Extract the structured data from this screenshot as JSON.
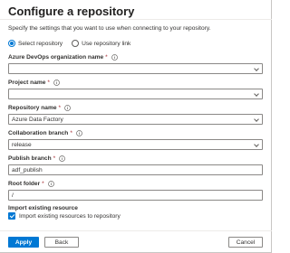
{
  "header": {
    "title": "Configure a repository",
    "subtitle": "Specify the settings that you want to use when connecting to your repository."
  },
  "source_options": [
    {
      "label": "Select repository",
      "checked": true
    },
    {
      "label": "Use repository link",
      "checked": false
    }
  ],
  "fields": {
    "organization": {
      "label": "Azure DevOps organization name",
      "required": true,
      "value": ""
    },
    "project": {
      "label": "Project name",
      "required": true,
      "value": ""
    },
    "repository": {
      "label": "Repository name",
      "required": true,
      "value": "Azure Data Factory"
    },
    "collaboration_branch": {
      "label": "Collaboration branch",
      "required": true,
      "value": "release"
    },
    "publish_branch": {
      "label": "Publish branch",
      "required": true,
      "value": "adf_publish"
    },
    "root_folder": {
      "label": "Root folder",
      "required": true,
      "value": "/"
    }
  },
  "import": {
    "label": "Import existing resource",
    "checkbox_label": "Import existing resources to repository",
    "checked": true
  },
  "footer": {
    "apply_label": "Apply",
    "back_label": "Back",
    "cancel_label": "Cancel"
  },
  "colors": {
    "accent": "#0078d4",
    "required": "#a4262c"
  },
  "icons": {
    "info": "info-icon",
    "dropdown": "chevron-down-icon"
  }
}
